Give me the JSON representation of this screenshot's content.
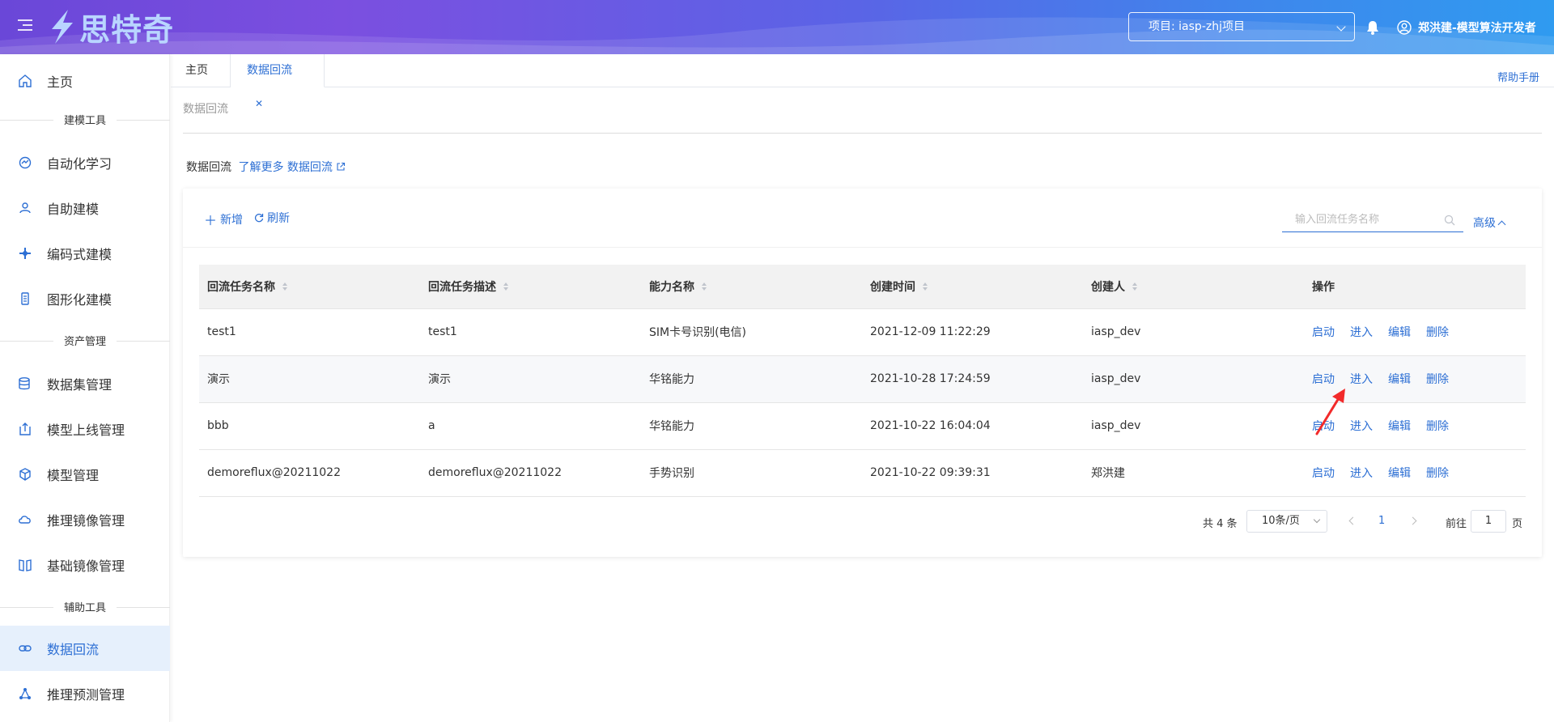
{
  "app": {
    "brand_name": "思特奇",
    "project_label": "项目: iasp-zhj项目",
    "user_label": "郑洪建-模型算法开发者"
  },
  "sidebar": {
    "home": "主页",
    "sections": [
      "建模工具",
      "资产管理",
      "辅助工具"
    ],
    "items": [
      {
        "label": "自动化学习",
        "icon": "automl-icon"
      },
      {
        "label": "自助建模",
        "icon": "self-modeling-icon"
      },
      {
        "label": "编码式建模",
        "icon": "code-modeling-icon"
      },
      {
        "label": "图形化建模",
        "icon": "graphic-modeling-icon"
      },
      {
        "label": "数据集管理",
        "icon": "dataset-icon"
      },
      {
        "label": "模型上线管理",
        "icon": "upload-icon"
      },
      {
        "label": "模型管理",
        "icon": "cube-icon"
      },
      {
        "label": "推理镜像管理",
        "icon": "cloud-icon"
      },
      {
        "label": "基础镜像管理",
        "icon": "book-icon"
      },
      {
        "label": "数据回流",
        "icon": "link-icon",
        "active": true
      },
      {
        "label": "推理预测管理",
        "icon": "network-icon"
      }
    ]
  },
  "tabs": [
    {
      "label": "主页"
    },
    {
      "label": "数据回流",
      "active": true
    }
  ],
  "help_link": "帮助手册",
  "breadcrumb": "数据回流",
  "intro": {
    "text": "数据回流",
    "link": "了解更多 数据回流"
  },
  "toolbar": {
    "add": "新增",
    "refresh": "刷新",
    "search_placeholder": "输入回流任务名称",
    "advanced": "高级"
  },
  "table": {
    "columns": [
      "回流任务名称",
      "回流任务描述",
      "能力名称",
      "创建时间",
      "创建人",
      "操作"
    ],
    "actions": [
      "启动",
      "进入",
      "编辑",
      "删除"
    ],
    "rows": [
      {
        "name": "test1",
        "desc": "test1",
        "ability": "SIM卡号识别(电信)",
        "created": "2021-12-09 11:22:29",
        "creator": "iasp_dev"
      },
      {
        "name": "演示",
        "desc": "演示",
        "ability": "华铭能力",
        "created": "2021-10-28 17:24:59",
        "creator": "iasp_dev"
      },
      {
        "name": "bbb",
        "desc": "a",
        "ability": "华铭能力",
        "created": "2021-10-22 16:04:04",
        "creator": "iasp_dev"
      },
      {
        "name": "demoreflux@20211022",
        "desc": "demoreflux@20211022",
        "ability": "手势识别",
        "created": "2021-10-22 09:39:31",
        "creator": "郑洪建"
      }
    ]
  },
  "pagination": {
    "total": "共 4 条",
    "page_size": "10条/页",
    "current_page": "1",
    "goto_label": "前往",
    "goto_value": "1",
    "page_unit": "页"
  },
  "colors": {
    "accent": "#2d6fd4",
    "annotation_arrow": "#f22a2a"
  }
}
